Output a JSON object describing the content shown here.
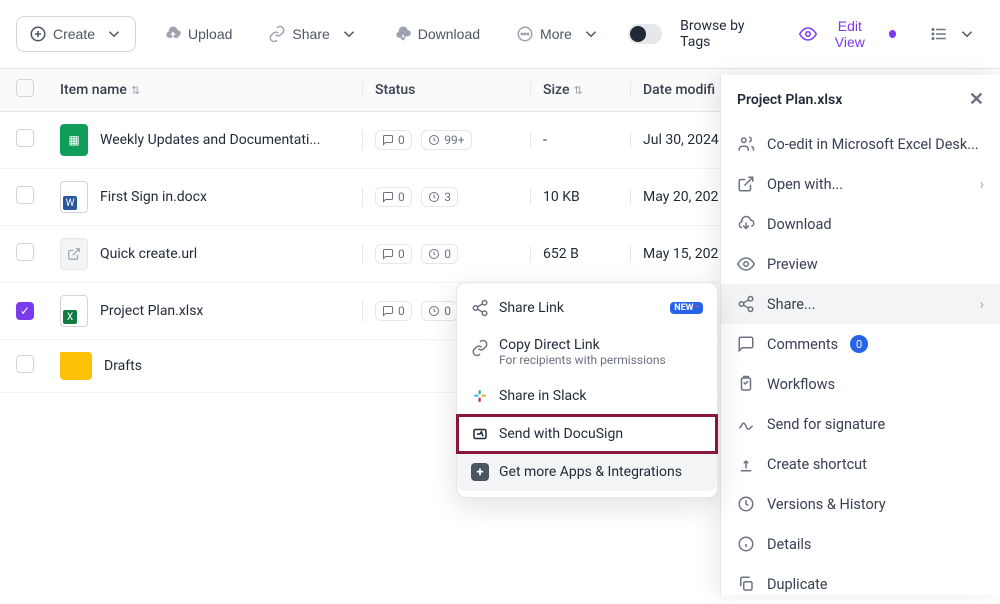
{
  "toolbar": {
    "create": "Create",
    "upload": "Upload",
    "share": "Share",
    "download": "Download",
    "more": "More",
    "browseByTags": "Browse by Tags",
    "editView": "Edit View"
  },
  "columns": {
    "name": "Item name",
    "status": "Status",
    "size": "Size",
    "date": "Date modifi"
  },
  "rows": [
    {
      "name": "Weekly Updates and Documentati...",
      "comments": "0",
      "versions": "99+",
      "size": "-",
      "date": "Jul 30, 2024",
      "icon": "sheets",
      "checked": false
    },
    {
      "name": "First Sign in.docx",
      "comments": "0",
      "versions": "3",
      "size": "10 KB",
      "date": "May 20, 202",
      "icon": "word",
      "checked": false
    },
    {
      "name": "Quick create.url",
      "comments": "0",
      "versions": "0",
      "size": "652 B",
      "date": "May 15, 202",
      "icon": "url",
      "checked": false
    },
    {
      "name": "Project Plan.xlsx",
      "comments": "0",
      "versions": "0",
      "size": "",
      "date": "",
      "icon": "excel",
      "checked": true
    },
    {
      "name": "Drafts",
      "comments": "",
      "versions": "",
      "size": "",
      "date": "",
      "icon": "folder",
      "checked": false
    }
  ],
  "panel": {
    "title": "Project Plan.xlsx",
    "items": {
      "coedit": "Co-edit in Microsoft Excel Desk...",
      "openWith": "Open with...",
      "download": "Download",
      "preview": "Preview",
      "share": "Share...",
      "comments": "Comments",
      "commentsCount": "0",
      "workflows": "Workflows",
      "sendSig": "Send for signature",
      "shortcut": "Create shortcut",
      "versions": "Versions & History",
      "details": "Details",
      "duplicate": "Duplicate"
    }
  },
  "submenu": {
    "shareLink": "Share Link",
    "newBadge": "NEW",
    "copyDirect": "Copy Direct Link",
    "copyDirectSub": "For recipients with permissions",
    "slack": "Share in Slack",
    "docusign": "Send with DocuSign",
    "integrations": "Get more Apps & Integrations"
  }
}
